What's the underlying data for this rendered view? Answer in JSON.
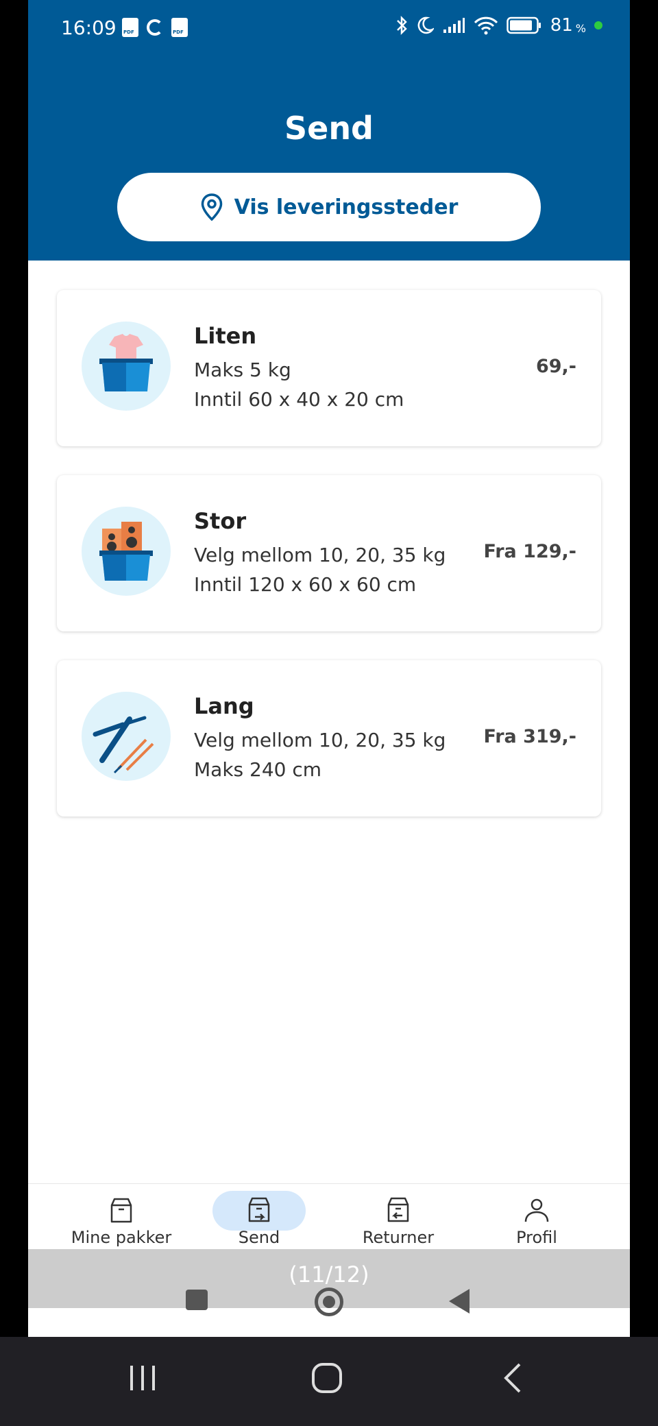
{
  "status_bar": {
    "time": "16:09",
    "battery": "81",
    "battery_unit": "%"
  },
  "header": {
    "title": "Send",
    "locations_button": "Vis leveringssteder",
    "locations_icon": "location-pin-icon"
  },
  "cards": [
    {
      "title": "Liten",
      "line1": "Maks 5 kg",
      "line2": "Inntil 60 x 40 x 20 cm",
      "price": "69,-",
      "icon": "small-package-icon"
    },
    {
      "title": "Stor",
      "line1": "Velg mellom 10, 20, 35 kg",
      "line2": "Inntil 120 x 60 x 60 cm",
      "price": "Fra 129,-",
      "icon": "large-package-icon"
    },
    {
      "title": "Lang",
      "line1": "Velg mellom 10, 20, 35 kg",
      "line2": "Maks 240 cm",
      "price": "Fra 319,-",
      "icon": "long-package-icon"
    }
  ],
  "bottom_nav": [
    {
      "label": "Mine pakker",
      "icon": "package-icon",
      "active": false
    },
    {
      "label": "Send",
      "icon": "send-package-icon",
      "active": true
    },
    {
      "label": "Returner",
      "icon": "return-package-icon",
      "active": false
    },
    {
      "label": "Profil",
      "icon": "profile-icon",
      "active": false
    }
  ],
  "overlay": {
    "counter": "(11/12)"
  },
  "colors": {
    "brand_blue": "#005a96",
    "active_nav_bg": "#d5e8fb",
    "icon_circle_bg": "#dff3fb"
  }
}
